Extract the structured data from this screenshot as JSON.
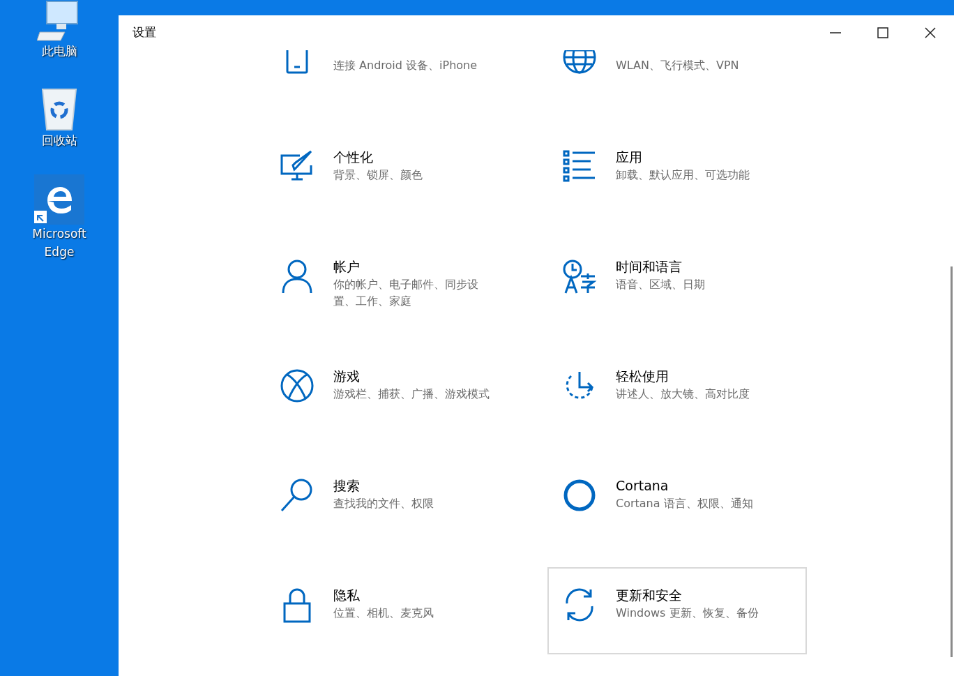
{
  "desktop_icons": [
    {
      "kind": "computer",
      "label": "此电脑"
    },
    {
      "kind": "recycle",
      "label": "回收站"
    },
    {
      "kind": "edge",
      "label": "Microsoft Edge"
    }
  ],
  "window": {
    "title": "设置"
  },
  "settings_items": [
    {
      "kind": "phone",
      "description": "连接 Android 设备、iPhone",
      "highlighted": false
    },
    {
      "kind": "globe",
      "description": "WLAN、飞行模式、VPN",
      "highlighted": false
    },
    {
      "kind": "personalize",
      "title": "个性化",
      "description": "背景、锁屏、颜色",
      "highlighted": false
    },
    {
      "kind": "apps",
      "title": "应用",
      "description": "卸载、默认应用、可选功能",
      "highlighted": false
    },
    {
      "kind": "account",
      "title": "帐户",
      "description": "你的帐户、电子邮件、同步设置、工作、家庭",
      "highlighted": false
    },
    {
      "kind": "time",
      "title": "时间和语言",
      "description": "语音、区域、日期",
      "highlighted": false
    },
    {
      "kind": "xbox",
      "title": "游戏",
      "description": "游戏栏、捕获、广播、游戏模式",
      "highlighted": false
    },
    {
      "kind": "ease",
      "title": "轻松使用",
      "description": "讲述人、放大镜、高对比度",
      "highlighted": false
    },
    {
      "kind": "search",
      "title": "搜索",
      "description": "查找我的文件、权限",
      "highlighted": false
    },
    {
      "kind": "cortana",
      "title": "Cortana",
      "description": "Cortana 语言、权限、通知",
      "highlighted": false
    },
    {
      "kind": "lock",
      "title": "隐私",
      "description": "位置、相机、麦克风",
      "highlighted": false
    },
    {
      "kind": "update",
      "title": "更新和安全",
      "description": "Windows 更新、恢复、备份",
      "highlighted": true
    }
  ]
}
